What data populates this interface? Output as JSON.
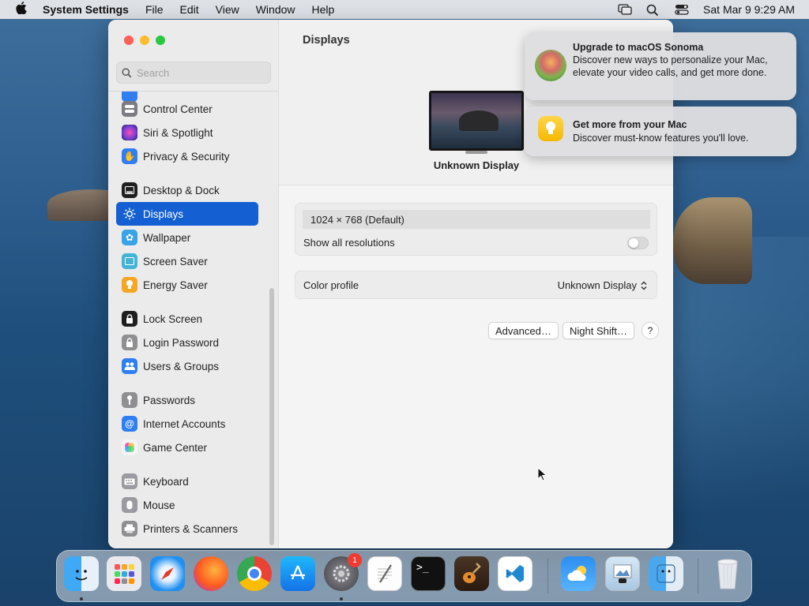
{
  "menubar": {
    "app_name": "System Settings",
    "menus": [
      "File",
      "Edit",
      "View",
      "Window",
      "Help"
    ],
    "datetime": "Sat Mar 9  9:29 AM"
  },
  "window": {
    "search_placeholder": "Search",
    "page_title": "Displays",
    "sidebar_items": [
      {
        "label": "Control Center",
        "icon": "control-center-icon",
        "color": "#7c7c82"
      },
      {
        "label": "Siri & Spotlight",
        "icon": "siri-icon",
        "color": "#6e3cd2"
      },
      {
        "label": "Privacy & Security",
        "icon": "hand-icon",
        "color": "#2f7ef2"
      },
      {
        "label": "Desktop & Dock",
        "icon": "dock-icon",
        "color": "#1f1f1f"
      },
      {
        "label": "Displays",
        "icon": "sun-icon",
        "color": "#2f7ef2",
        "active": true
      },
      {
        "label": "Wallpaper",
        "icon": "flower-icon",
        "color": "#38a3e6"
      },
      {
        "label": "Screen Saver",
        "icon": "screen-saver-icon",
        "color": "#44b3d6"
      },
      {
        "label": "Energy Saver",
        "icon": "bulb-icon",
        "color": "#f5a623"
      },
      {
        "label": "Lock Screen",
        "icon": "lock-icon",
        "color": "#1f1f1f"
      },
      {
        "label": "Login Password",
        "icon": "padlock-icon",
        "color": "#8e8e93"
      },
      {
        "label": "Users & Groups",
        "icon": "users-icon",
        "color": "#2f7ef2"
      },
      {
        "label": "Passwords",
        "icon": "key-icon",
        "color": "#8e8e93"
      },
      {
        "label": "Internet Accounts",
        "icon": "at-icon",
        "color": "#2f7ef2"
      },
      {
        "label": "Game Center",
        "icon": "game-center-icon",
        "color": "#e8e8ea"
      },
      {
        "label": "Keyboard",
        "icon": "keyboard-icon",
        "color": "#9a9aa0"
      },
      {
        "label": "Mouse",
        "icon": "mouse-icon",
        "color": "#9a9aa0"
      },
      {
        "label": "Printers & Scanners",
        "icon": "printer-icon",
        "color": "#8e8e93"
      }
    ],
    "display": {
      "name": "Unknown Display",
      "resolution": "1024 × 768 (Default)",
      "show_all_resolutions_label": "Show all resolutions",
      "show_all_resolutions_on": false,
      "color_profile_label": "Color profile",
      "color_profile_value": "Unknown Display",
      "advanced_button": "Advanced…",
      "night_shift_button": "Night Shift…",
      "help_button": "?"
    }
  },
  "notifications": [
    {
      "title": "Upgrade to macOS Sonoma",
      "body": "Discover new ways to personalize your Mac, elevate your video calls, and get more done.",
      "icon": "sonoma-icon"
    },
    {
      "title": "Get more from your Mac",
      "body": "Discover must-know features you'll love.",
      "icon": "tips-icon"
    }
  ],
  "dock": {
    "apps": [
      "finder",
      "launchpad",
      "safari",
      "firefox",
      "chrome",
      "app-store",
      "system-settings",
      "textedit",
      "terminal",
      "garageband",
      "vscode",
      "weather",
      "preview",
      "finder-folder",
      "trash"
    ],
    "settings_badge": "1"
  },
  "accent_color": "#1460d2"
}
